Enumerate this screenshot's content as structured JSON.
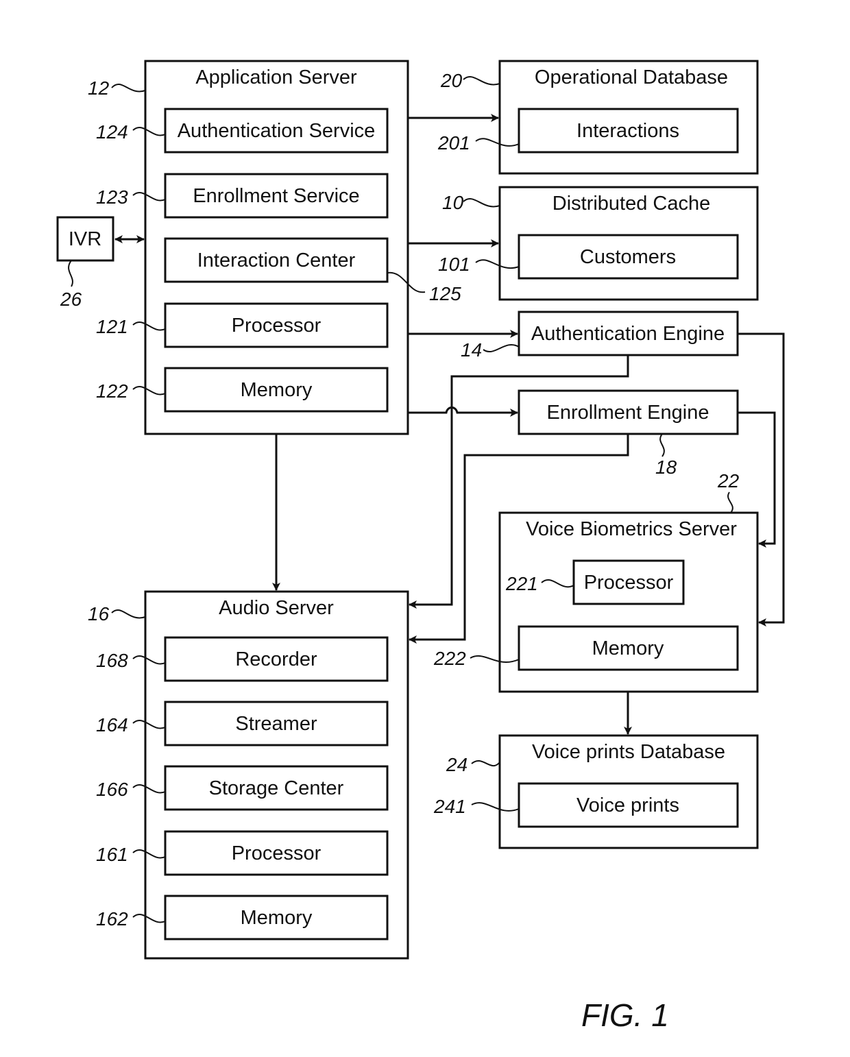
{
  "figure": {
    "caption": "FIG. 1",
    "ink_color": "#111111",
    "background": "#ffffff"
  },
  "blocks": {
    "app_server": {
      "title": "Application Server",
      "ref": "12",
      "children": [
        {
          "label": "Authentication Service",
          "ref": "124"
        },
        {
          "label": "Enrollment Service",
          "ref": "123"
        },
        {
          "label": "Interaction Center",
          "ref": "125"
        },
        {
          "label": "Processor",
          "ref": "121"
        },
        {
          "label": "Memory",
          "ref": "122"
        }
      ]
    },
    "ivr": {
      "title": "IVR",
      "ref": "26"
    },
    "op_db": {
      "title": "Operational Database",
      "ref": "20",
      "child": {
        "label": "Interactions",
        "ref": "201"
      }
    },
    "dist_cache": {
      "title": "Distributed Cache",
      "ref": "10",
      "child": {
        "label": "Customers",
        "ref": "101"
      }
    },
    "auth_engine": {
      "title": "Authentication Engine",
      "ref": "14"
    },
    "enroll_engine": {
      "title": "Enrollment Engine",
      "ref": "18"
    },
    "vb_server": {
      "title": "Voice Biometrics Server",
      "ref": "22",
      "children": [
        {
          "label": "Processor",
          "ref": "221"
        },
        {
          "label": "Memory",
          "ref": "222"
        }
      ]
    },
    "vp_db": {
      "title": "Voice prints Database",
      "ref": "24",
      "child": {
        "label": "Voice prints",
        "ref": "241"
      }
    },
    "audio_server": {
      "title": "Audio Server",
      "ref": "16",
      "children": [
        {
          "label": "Recorder",
          "ref": "168"
        },
        {
          "label": "Streamer",
          "ref": "164"
        },
        {
          "label": "Storage Center",
          "ref": "166"
        },
        {
          "label": "Processor",
          "ref": "161"
        },
        {
          "label": "Memory",
          "ref": "162"
        }
      ]
    }
  },
  "connections": [
    {
      "from": "ivr",
      "to": "app_server",
      "direction": "bidirectional"
    },
    {
      "from": "app_server",
      "to": "op_db",
      "direction": "forward"
    },
    {
      "from": "app_server",
      "to": "dist_cache",
      "direction": "forward"
    },
    {
      "from": "app_server",
      "to": "auth_engine",
      "direction": "forward"
    },
    {
      "from": "app_server",
      "to": "enroll_engine",
      "direction": "forward"
    },
    {
      "from": "app_server",
      "to": "audio_server",
      "direction": "forward"
    },
    {
      "from": "auth_engine",
      "to": "audio_server",
      "direction": "forward"
    },
    {
      "from": "enroll_engine",
      "to": "audio_server",
      "direction": "forward"
    },
    {
      "from": "auth_engine",
      "to": "vb_server",
      "direction": "forward"
    },
    {
      "from": "enroll_engine",
      "to": "vb_server",
      "direction": "forward"
    },
    {
      "from": "vb_server",
      "to": "vp_db",
      "direction": "forward"
    }
  ]
}
